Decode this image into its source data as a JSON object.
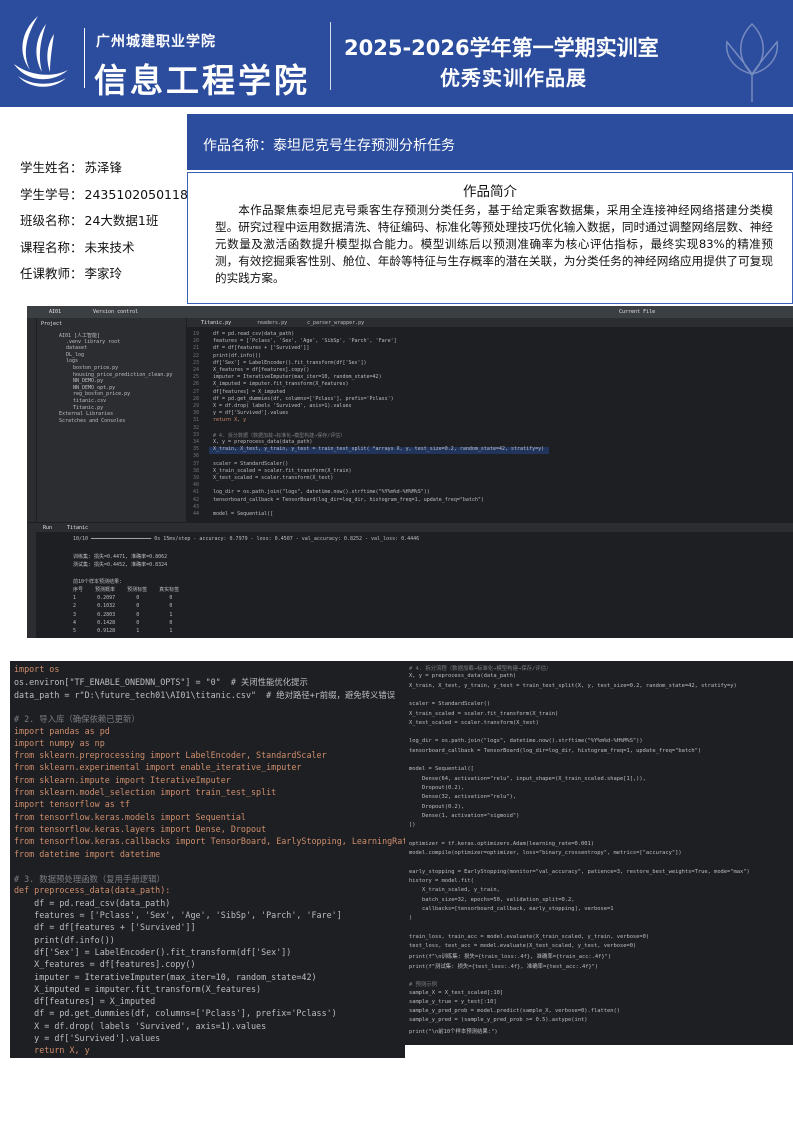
{
  "header": {
    "school": "广州城建职业学院",
    "college": "信息工程学院",
    "title_line1": "2025-2026学年第一学期实训室",
    "title_line2": "优秀实训作品展"
  },
  "student": {
    "name_label": "学生姓名：",
    "name": "苏泽锋",
    "id_label": "学生学号：",
    "id": "2435102050118",
    "class_label": "班级名称：",
    "class": "24大数据1班",
    "course_label": "课程名称：",
    "course": "未来技术",
    "teacher_label": "任课教师：",
    "teacher": "李家玲"
  },
  "work": {
    "title": "作品名称：泰坦尼克号生存预测分析任务",
    "intro_heading": "作品简介",
    "intro_text": "本作品聚焦泰坦尼克号乘客生存预测分类任务，基于给定乘客数据集，采用全连接神经网络搭建分类模型。研究过程中运用数据清洗、特征编码、标准化等预处理技巧优化输入数据，同时通过调整网络层数、神经元数量及激活函数提升模型拟合能力。模型训练后以预测准确率为核心评估指标，最终实现83%的精准预测，有效挖掘乘客性别、舱位、年龄等特征与生存概率的潜在关联，为分类任务的神经网络应用提供了可复现的实践方案。"
  },
  "ide": {
    "project_label": "Project",
    "vcs_label": "Version control",
    "current_file": "Current File",
    "tabs": [
      "Titanic.py",
      "readers.py",
      "c_parser_wrapper.py"
    ],
    "tree": [
      "AI01 [人工智能]",
      ".venv  library root",
      "dataset",
      "DL_log",
      "logs",
      "boston_price.py",
      "housing_price_prediction_clean.py",
      "NN_DEMO.py",
      "NN_DEMO_opt.py",
      "reg_boston_price.py",
      "titanic.csv",
      "Titanic.py",
      "External Libraries",
      "Scratches and Consoles"
    ],
    "editor_lines": [
      "df = pd.read_csv(data_path)",
      "features = ['Pclass', 'Sex', 'Age', 'SibSp', 'Parch', 'Fare']",
      "df = df[features + ['Survived']]",
      "print(df.info())",
      "df['Sex'] = LabelEncoder().fit_transform(df['Sex'])",
      "X_features = df[features].copy()",
      "imputer = IterativeImputer(max_iter=10, random_state=42)",
      "X_imputed = imputer.fit_transform(X_features)",
      "df[features] = X_imputed",
      "df = pd.get_dummies(df, columns=['Pclass'], prefix='Pclass')",
      "X = df.drop( labels 'Survived', axis=1).values",
      "y = df['Survived'].values",
      "return X, y",
      "",
      "# 4. 拆分数据（数据加载→标准化→模型构建→保存/评估）",
      "X, y = preprocess_data(data_path)",
      "X_train, X_test, y_train, y_test = train_test_split( *arrays X, y, test_size=0.2, random_state=42, stratify=y)",
      "",
      "scaler = StandardScaler()",
      "X_train_scaled = scaler.fit_transform(X_train)",
      "X_test_scaled = scaler.transform(X_test)",
      "",
      "log_dir = os.path.join(\"logs\", datetime.now().strftime(\"%Y%m%d-%H%M%S\"))",
      "tensorboard_callback = TensorBoard(log_dir=log_dir, histogram_freq=1, update_freq=\"batch\")",
      "",
      "model = Sequential(["
    ],
    "run_label": "Run",
    "run_tab": "Titanic",
    "console_lines": [
      "10/10 ━━━━━━━━━━━━━━━━━━━━ 0s 15ms/step - accuracy: 0.7979 - loss: 0.4507 - val_accuracy: 0.8252 - val_loss: 0.4446",
      "",
      "训练集: 损失=0.4471, 准确率=0.8062",
      "测试集: 损失=0.4452, 准确率=0.8324",
      "",
      "前10个样本预测结果:",
      "序号    预测概率    预测标签    真实标签",
      "1       0.2097       0          0",
      "2       0.1032       0          0",
      "3       0.2803       0          1",
      "4       0.1428       0          0",
      "5       0.9128       1          1"
    ]
  },
  "code_left": [
    "import os",
    "os.environ[\"TF_ENABLE_ONEDNN_OPTS\"] = \"0\"  # 关闭性能优化提示",
    "data_path = r\"D:\\future_tech01\\AI01\\titanic.csv\"  # 绝对路径+r前缀，避免转义错误",
    "",
    "# 2. 导入库（确保依赖已更新）",
    "import pandas as pd",
    "import numpy as np",
    "from sklearn.preprocessing import LabelEncoder, StandardScaler",
    "from sklearn.experimental import enable_iterative_imputer",
    "from sklearn.impute import IterativeImputer",
    "from sklearn.model_selection import train_test_split",
    "import tensorflow as tf",
    "from tensorflow.keras.models import Sequential",
    "from tensorflow.keras.layers import Dense, Dropout",
    "from tensorflow.keras.callbacks import TensorBoard, EarlyStopping, LearningRateScheduler",
    "from datetime import datetime",
    "",
    "# 3. 数据预处理函数（复用手册逻辑）",
    "def preprocess_data(data_path):",
    "    df = pd.read_csv(data_path)",
    "    features = ['Pclass', 'Sex', 'Age', 'SibSp', 'Parch', 'Fare']",
    "    df = df[features + ['Survived']]",
    "    print(df.info())",
    "    df['Sex'] = LabelEncoder().fit_transform(df['Sex'])",
    "    X_features = df[features].copy()",
    "    imputer = IterativeImputer(max_iter=10, random_state=42)",
    "    X_imputed = imputer.fit_transform(X_features)",
    "    df[features] = X_imputed",
    "    df = pd.get_dummies(df, columns=['Pclass'], prefix='Pclass')",
    "    X = df.drop( labels 'Survived', axis=1).values",
    "    y = df['Survived'].values",
    "    return X, y"
  ],
  "code_right": [
    "# 4. 拆分流程（数据加载→标准化→模型构建→保存/评估）",
    "X, y = preprocess_data(data_path)",
    "X_train, X_test, y_train, y_test = train_test_split(X, y, test_size=0.2, random_state=42, stratify=y)",
    "",
    "scaler = StandardScaler()",
    "X_train_scaled = scaler.fit_transform(X_train)",
    "X_test_scaled = scaler.transform(X_test)",
    "",
    "log_dir = os.path.join(\"logs\", datetime.now().strftime(\"%Y%m%d-%H%M%S\"))",
    "tensorboard_callback = TensorBoard(log_dir=log_dir, histogram_freq=1, update_freq=\"batch\")",
    "",
    "model = Sequential([",
    "    Dense(64, activation=\"relu\", input_shape=(X_train_scaled.shape[1],)),",
    "    Dropout(0.2),",
    "    Dense(32, activation=\"relu\"),",
    "    Dropout(0.2),",
    "    Dense(1, activation=\"sigmoid\")",
    "])",
    "",
    "optimizer = tf.keras.optimizers.Adam(learning_rate=0.001)",
    "model.compile(optimizer=optimizer, loss=\"binary_crossentropy\", metrics=[\"accuracy\"])",
    "",
    "early_stopping = EarlyStopping(monitor=\"val_accuracy\", patience=3, restore_best_weights=True, mode=\"max\")",
    "history = model.fit(",
    "    X_train_scaled, y_train,",
    "    batch_size=32, epochs=50, validation_split=0.2,",
    "    callbacks=[tensorboard_callback, early_stopping], verbose=1",
    ")",
    "",
    "train_loss, train_acc = model.evaluate(X_train_scaled, y_train, verbose=0)",
    "test_loss, test_acc = model.evaluate(X_test_scaled, y_test, verbose=0)",
    "print(f\"\\n训练集: 损失={train_loss:.4f}, 准确率={train_acc:.4f}\")",
    "print(f\"测试集: 损失={test_loss:.4f}, 准确率={test_acc:.4f}\")",
    "",
    "# 预测示例",
    "sample_X = X_test_scaled[:10]",
    "sample_y_true = y_test[:10]",
    "sample_y_pred_prob = model.predict(sample_X, verbose=0).flatten()",
    "sample_y_pred = (sample_y_pred_prob >= 0.5).astype(int)",
    "print(\"\\n前10个样本预测结果:\")"
  ]
}
